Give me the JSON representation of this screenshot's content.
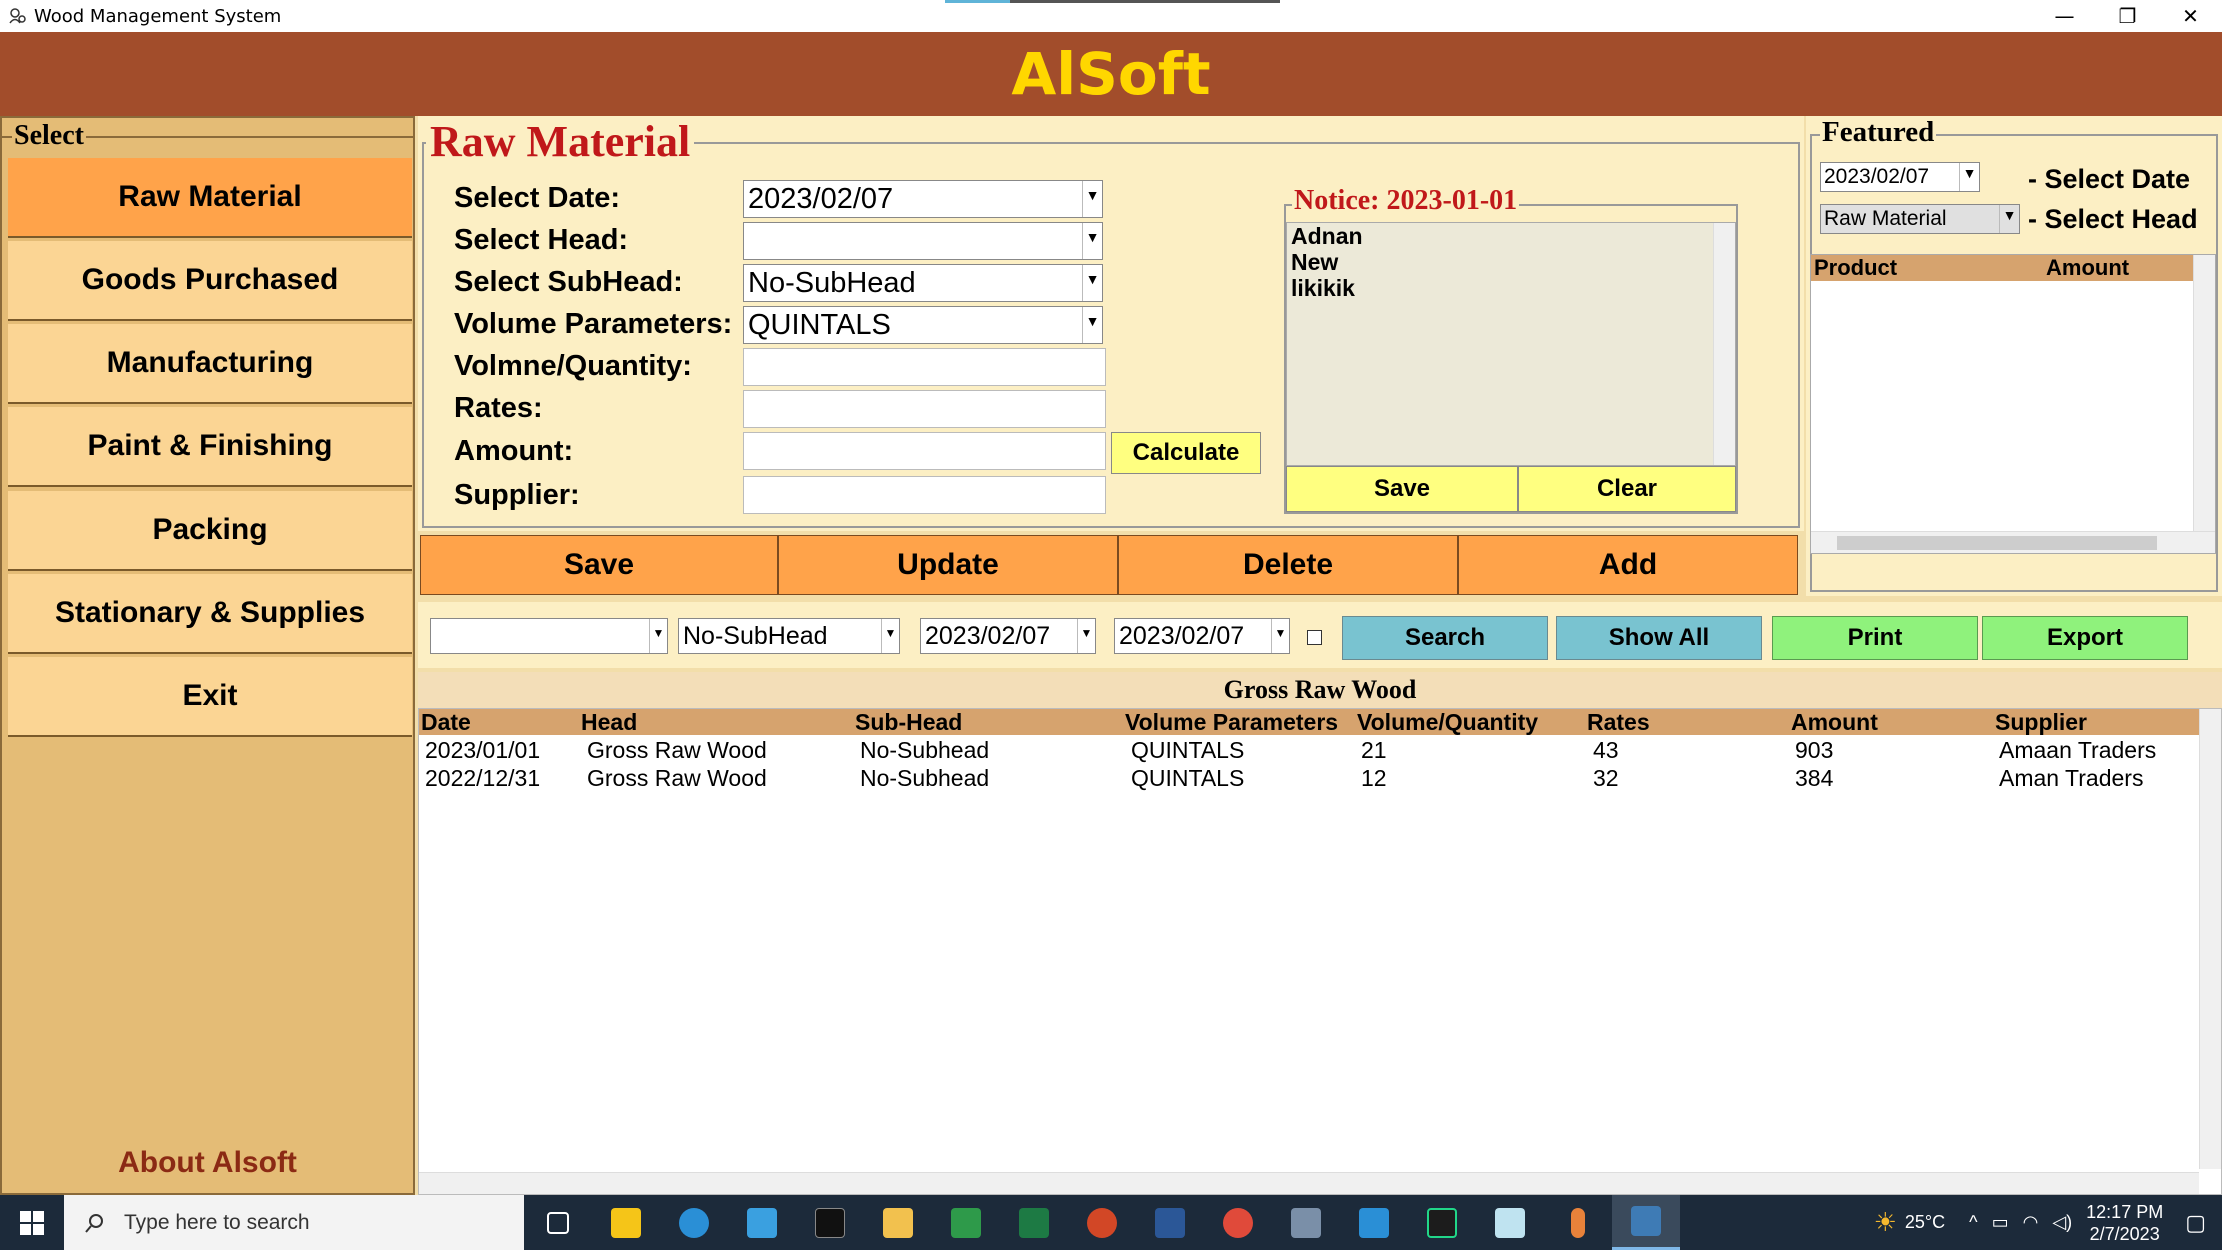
{
  "window": {
    "title": "Wood Management System",
    "minimize": "—",
    "maximize": "❐",
    "close": "✕"
  },
  "banner": {
    "title": "AlSoft"
  },
  "left": {
    "legend": "Select",
    "items": [
      {
        "label": "Raw Material"
      },
      {
        "label": "Goods Purchased"
      },
      {
        "label": "Manufacturing"
      },
      {
        "label": "Paint & Finishing"
      },
      {
        "label": "Packing"
      },
      {
        "label": "Stationary & Supplies"
      },
      {
        "label": "Exit"
      }
    ],
    "about": "About Alsoft"
  },
  "form": {
    "title": "Raw Material",
    "labels": {
      "date": "Select Date:",
      "head": "Select Head:",
      "subhead": "Select SubHead:",
      "volume_params": "Volume Parameters:",
      "quantity": "Volmne/Quantity:",
      "rates": "Rates:",
      "amount": "Amount:",
      "supplier": "Supplier:"
    },
    "values": {
      "date": "2023/02/07",
      "head": "",
      "subhead": "No-SubHead",
      "volume_params": "QUINTALS",
      "quantity": "",
      "rates": "",
      "amount": "",
      "supplier": ""
    },
    "calculate": "Calculate"
  },
  "notice": {
    "legend": "Notice: 2023-01-01",
    "lines": [
      "Adnan",
      "New",
      "likikik"
    ],
    "save": "Save",
    "clear": "Clear"
  },
  "actions": {
    "save": "Save",
    "update": "Update",
    "delete": "Delete",
    "add": "Add"
  },
  "featured": {
    "legend": "Featured",
    "date": "2023/02/07",
    "date_label": "- Select Date",
    "head": "Raw Material",
    "head_label": "- Select Head",
    "columns": [
      "Product",
      "Amount"
    ]
  },
  "search": {
    "head": "",
    "subhead": "No-SubHead",
    "from": "2023/02/07",
    "to": "2023/02/07",
    "search": "Search",
    "show_all": "Show All",
    "print": "Print",
    "export": "Export"
  },
  "table": {
    "title": "Gross Raw Wood",
    "columns": [
      "Date",
      "Head",
      "Sub-Head",
      "Volume Parameters",
      "Volume/Quantity",
      "Rates",
      "Amount",
      "Supplier"
    ],
    "rows": [
      [
        "2023/01/01",
        "Gross Raw Wood",
        "No-Subhead",
        "QUINTALS",
        "21",
        "43",
        "903",
        "Amaan Traders"
      ],
      [
        "2022/12/31",
        "Gross Raw Wood",
        "No-Subhead",
        "QUINTALS",
        "12",
        "32",
        "384",
        "Aman Traders"
      ]
    ]
  },
  "taskbar": {
    "search_placeholder": "Type here to search",
    "weather": "25°C",
    "time": "12:17 PM",
    "date": "2/7/2023"
  }
}
